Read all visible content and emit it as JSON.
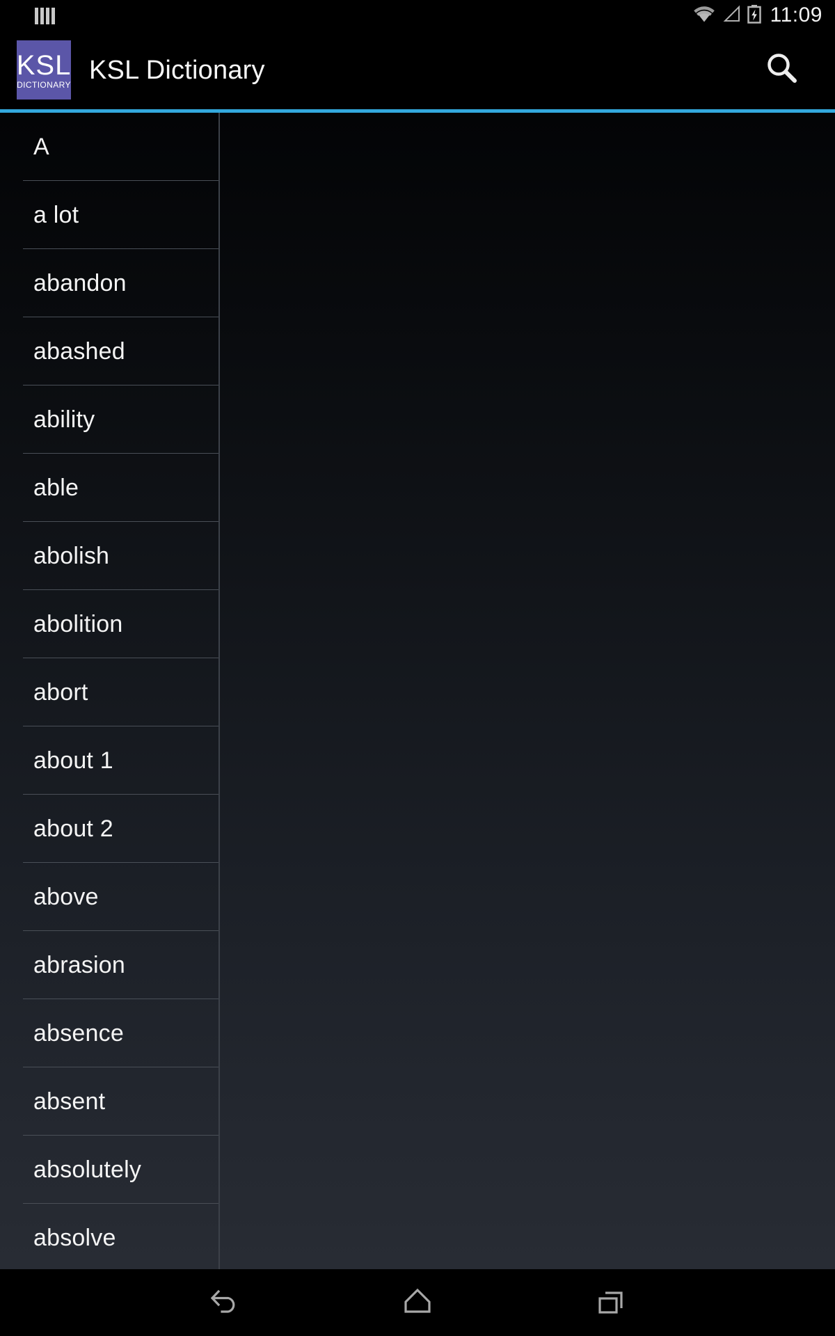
{
  "status_bar": {
    "notification_icon": "notification-bars-icon",
    "wifi_icon": "wifi-icon",
    "signal_icon": "cellular-signal-icon",
    "battery_icon": "battery-charging-icon",
    "time": "11:09"
  },
  "action_bar": {
    "app_icon": {
      "name": "ksl-app-icon",
      "line1": "KSL",
      "line2": "DICTIONARY",
      "background_color": "#5b56a8"
    },
    "title": "KSL Dictionary",
    "search_icon": "search-icon"
  },
  "accent_color": "#33a8dd",
  "word_list": {
    "items": [
      {
        "label": "A"
      },
      {
        "label": "a lot"
      },
      {
        "label": "abandon"
      },
      {
        "label": "abashed"
      },
      {
        "label": "ability"
      },
      {
        "label": "able"
      },
      {
        "label": "abolish"
      },
      {
        "label": "abolition"
      },
      {
        "label": "abort"
      },
      {
        "label": "about 1"
      },
      {
        "label": "about 2"
      },
      {
        "label": "above"
      },
      {
        "label": "abrasion"
      },
      {
        "label": "absence"
      },
      {
        "label": "absent"
      },
      {
        "label": "absolutely"
      },
      {
        "label": "absolve"
      }
    ]
  },
  "nav_bar": {
    "back_icon": "back-arrow-icon",
    "home_icon": "home-icon",
    "recents_icon": "recent-apps-icon"
  }
}
